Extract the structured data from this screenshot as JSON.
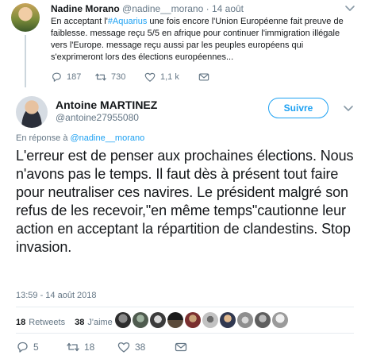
{
  "parent_tweet": {
    "author_name": "Nadine Morano",
    "author_handle": "@nadine__morano",
    "separator": "·",
    "time": "14 août",
    "text_before": "En acceptant l'",
    "hashtag": "#Aquarius",
    "text_after": " une fois encore l'Union Européenne fait preuve de faiblesse. message reçu 5/5 en afrique pour continuer l'immigration illégale vers l'Europe. message reçu aussi par les peuples européens qui s'exprimeront lors des élections européennes...",
    "replies": "187",
    "retweets": "730",
    "likes": "1,1 k"
  },
  "main_tweet": {
    "author_name": "Antoine MARTINEZ",
    "author_handle": "@antoine27955080",
    "follow_label": "Suivre",
    "reply_prefix": "En réponse à ",
    "reply_mention": "@nadine__morano",
    "text": "L'erreur est de penser aux prochaines élections. Nous n'avons pas le temps. Il faut dès à présent tout faire pour neutraliser ces navires. Le président malgré son refus de les recevoir,\"en même temps\"cautionne leur action en acceptant la répartition de clandestins. Stop invasion.",
    "timestamp": "13:59 - 14 août 2018",
    "retweet_count": "18",
    "retweet_label": "Retweets",
    "like_count": "38",
    "like_label": "J'aime",
    "replies": "5",
    "retweets": "18",
    "likes": "38"
  },
  "colors": {
    "accent": "#1da1f2",
    "text_primary": "#14171a",
    "text_secondary": "#657786",
    "divider": "#e6ecf0"
  },
  "icons": [
    "chevron-down-icon",
    "reply-icon",
    "retweet-icon",
    "heart-icon",
    "messages-icon"
  ]
}
